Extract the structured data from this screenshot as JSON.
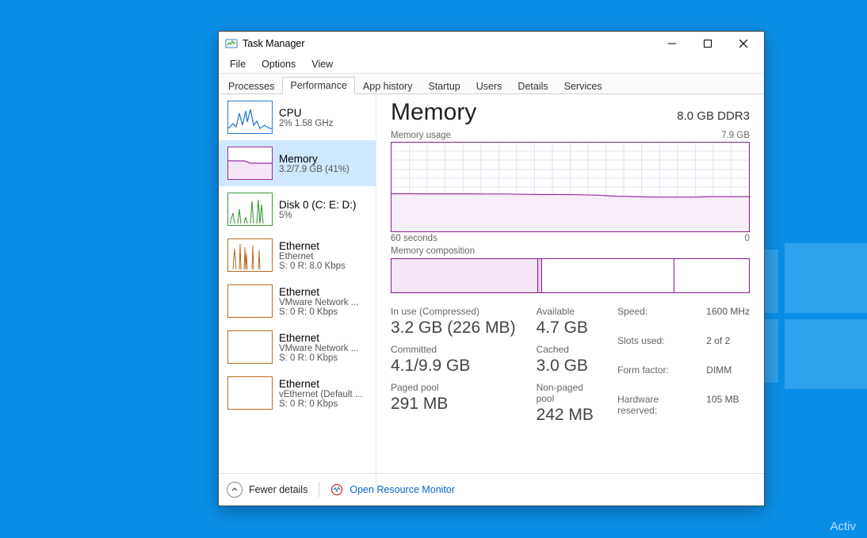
{
  "watermark": "Activ",
  "window": {
    "title": "Task Manager",
    "menus": [
      "File",
      "Options",
      "View"
    ],
    "tabs": [
      "Processes",
      "Performance",
      "App history",
      "Startup",
      "Users",
      "Details",
      "Services"
    ],
    "active_tab": 1
  },
  "sidebar": [
    {
      "title": "CPU",
      "sub": "2% 1.58 GHz",
      "color": "#2a7bd1",
      "selected": false
    },
    {
      "title": "Memory",
      "sub": "3.2/7.9 GB (41%)",
      "color": "#9b2fa0",
      "selected": true
    },
    {
      "title": "Disk 0 (C: E: D:)",
      "sub": "5%",
      "color": "#3a9a3a",
      "selected": false
    },
    {
      "title": "Ethernet",
      "sub": "Ethernet",
      "sub2": "S: 0 R: 8.0 Kbps",
      "color": "#b86a1c",
      "selected": false
    },
    {
      "title": "Ethernet",
      "sub": "VMware Network ...",
      "sub2": "S: 0 R: 0 Kbps",
      "color": "#b86a1c",
      "selected": false
    },
    {
      "title": "Ethernet",
      "sub": "VMware Network ...",
      "sub2": "S: 0 R: 0 Kbps",
      "color": "#b86a1c",
      "selected": false
    },
    {
      "title": "Ethernet",
      "sub": "vEthernet (Default ...",
      "sub2": "S: 0 R: 0 Kbps",
      "color": "#b86a1c",
      "selected": false
    }
  ],
  "main": {
    "title": "Memory",
    "spec": "8.0 GB DDR3",
    "usage_label": "Memory usage",
    "usage_max": "7.9 GB",
    "axis_left": "60 seconds",
    "axis_right": "0",
    "composition_label": "Memory composition",
    "stats_left": [
      {
        "lbl": "In use (Compressed)",
        "val": "3.2 GB (226 MB)"
      },
      {
        "lbl": "Committed",
        "val": "4.1/9.9 GB"
      },
      {
        "lbl": "Paged pool",
        "val": "291 MB"
      }
    ],
    "stats_mid": [
      {
        "lbl": "Available",
        "val": "4.7 GB"
      },
      {
        "lbl": "Cached",
        "val": "3.0 GB"
      },
      {
        "lbl": "Non-paged pool",
        "val": "242 MB"
      }
    ],
    "kv": [
      {
        "k": "Speed:",
        "v": "1600 MHz"
      },
      {
        "k": "Slots used:",
        "v": "2 of 2"
      },
      {
        "k": "Form factor:",
        "v": "DIMM"
      },
      {
        "k": "Hardware reserved:",
        "v": "105 MB"
      }
    ]
  },
  "footer": {
    "fewer": "Fewer details",
    "rm": "Open Resource Monitor"
  },
  "chart_data": {
    "type": "area",
    "title": "Memory usage",
    "ylabel": "GB",
    "ylim": [
      0,
      7.9
    ],
    "xlim_seconds": [
      60,
      0
    ],
    "series": [
      {
        "name": "In use",
        "values_gb": [
          3.35,
          3.35,
          3.34,
          3.34,
          3.34,
          3.33,
          3.33,
          3.3,
          3.28,
          3.28,
          3.26,
          3.22,
          3.12,
          3.08,
          3.05,
          3.05,
          3.05,
          3.08,
          3.08,
          3.08
        ]
      }
    ],
    "composition_fractions": {
      "in_use": 0.41,
      "modified": 0.01,
      "standby": 0.37,
      "free": 0.21
    }
  }
}
